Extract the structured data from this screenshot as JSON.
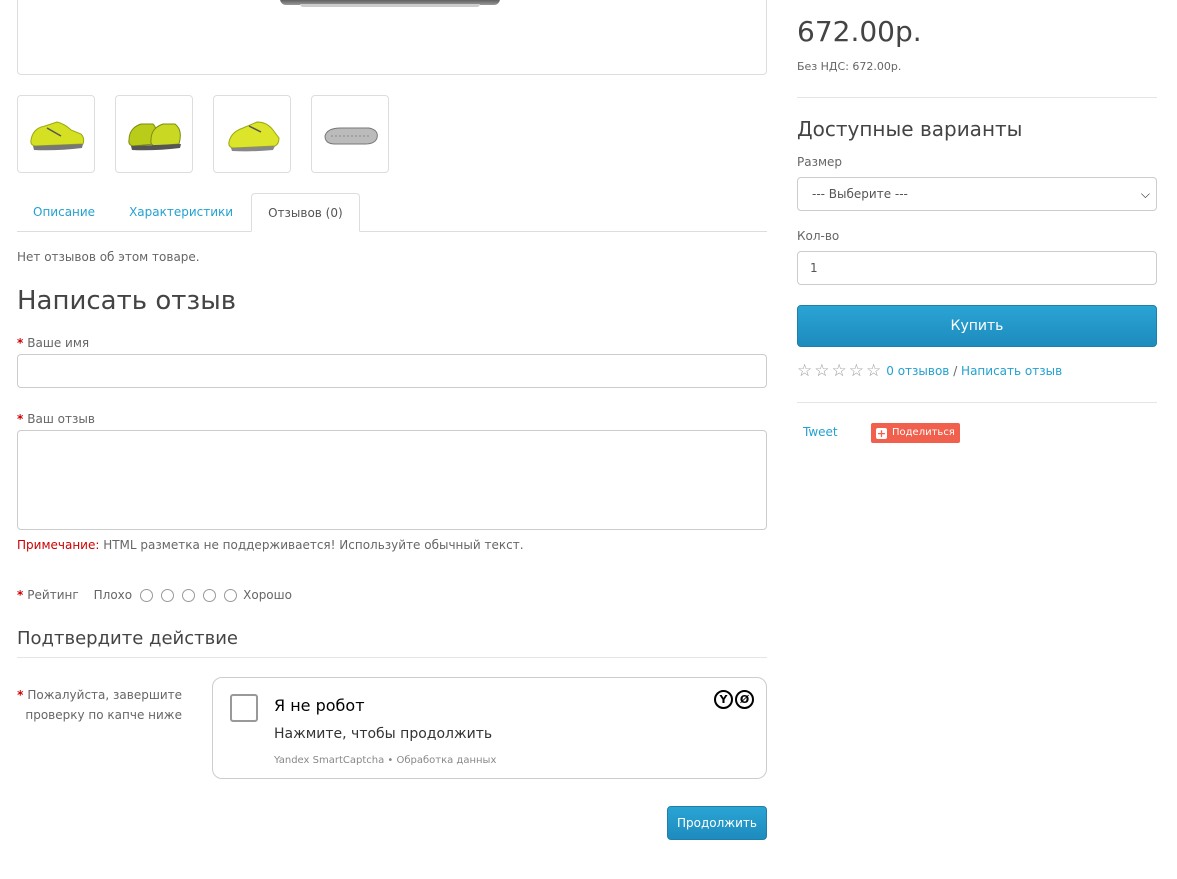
{
  "tabs": [
    {
      "label": "Описание"
    },
    {
      "label": "Характеристики"
    },
    {
      "label": "Отзывов (0)"
    }
  ],
  "reviews": {
    "no_reviews": "Нет отзывов об этом товаре.",
    "write_title": "Написать отзыв",
    "name_label": "Ваше имя",
    "name_value": "",
    "text_label": "Ваш отзыв",
    "text_value": "",
    "note_prefix": "Примечание:",
    "note_text": " HTML разметка не поддерживается! Используйте обычный текст.",
    "rating_label": "Рейтинг",
    "rating_bad": "Плохо",
    "rating_good": "Хорошо",
    "required_mark": "*"
  },
  "captcha": {
    "section_title": "Подтвердите действие",
    "label": "Пожалуйста, завершите проверку по капче ниже",
    "title": "Я не робот",
    "subtitle": "Нажмите, чтобы продолжить",
    "footer": "Yandex SmartCaptcha • Обработка данных",
    "logo_y": "Y",
    "logo_b": "Ø"
  },
  "buttons": {
    "continue": "Продолжить",
    "buy": "Купить"
  },
  "product": {
    "price": "672.00р.",
    "ex_tax": "Без НДС: 672.00р.",
    "variants_title": "Доступные варианты",
    "size_label": "Размер",
    "size_selected": "--- Выберите ---",
    "qty_label": "Кол-во",
    "qty_value": "1",
    "reviews_link": "0 отзывов",
    "separator": " / ",
    "write_review_link": "Написать отзыв"
  },
  "social": {
    "tweet": "Tweet",
    "share": "Поделиться"
  },
  "colors": {
    "accent": "#23a1d1",
    "button": "#229ac8",
    "required": "#cc0000",
    "share": "#f0604d",
    "shoe": "#c8d92a"
  }
}
